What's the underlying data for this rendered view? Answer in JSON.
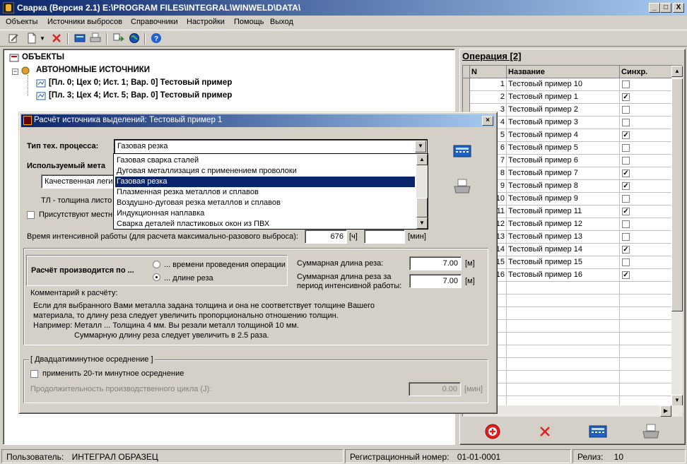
{
  "window": {
    "title": "Сварка (Версия 2.1) E:\\PROGRAM FILES\\INTEGRAL\\WINWELD\\DATA\\",
    "min": "_",
    "max": "□",
    "close": "X"
  },
  "menu": [
    "Объекты",
    "Источники выбросов",
    "Справочники",
    "Настройки",
    "Помощь",
    "Выход"
  ],
  "tree": {
    "root": "ОБЪЕКТЫ",
    "node": "АВТОНОМНЫЕ ИСТОЧНИКИ",
    "items": [
      "[Пл. 0; Цех 0; Ист. 1; Вар. 0] Тестовый пример",
      "[Пл. 3; Цех 4; Ист. 5; Вар. 0] Тестовый пример"
    ]
  },
  "operations": {
    "title": "Операция [2]",
    "columns": [
      "N",
      "Название",
      "Синхр."
    ],
    "rows": [
      {
        "n": "1",
        "name": "Тестовый пример 10",
        "sync": false
      },
      {
        "n": "2",
        "name": "Тестовый пример 1",
        "sync": true
      },
      {
        "n": "3",
        "name": "Тестовый пример 2",
        "sync": false
      },
      {
        "n": "4",
        "name": "Тестовый пример 3",
        "sync": false
      },
      {
        "n": "5",
        "name": "Тестовый пример 4",
        "sync": true
      },
      {
        "n": "6",
        "name": "Тестовый пример 5",
        "sync": false
      },
      {
        "n": "7",
        "name": "Тестовый пример 6",
        "sync": false
      },
      {
        "n": "8",
        "name": "Тестовый пример 7",
        "sync": true
      },
      {
        "n": "9",
        "name": "Тестовый пример 8",
        "sync": true
      },
      {
        "n": "10",
        "name": "Тестовый пример 9",
        "sync": false
      },
      {
        "n": "11",
        "name": "Тестовый пример 11",
        "sync": true
      },
      {
        "n": "12",
        "name": "Тестовый пример 12",
        "sync": false
      },
      {
        "n": "13",
        "name": "Тестовый пример 13",
        "sync": false
      },
      {
        "n": "14",
        "name": "Тестовый пример 14",
        "sync": true
      },
      {
        "n": "15",
        "name": "Тестовый пример 15",
        "sync": false
      },
      {
        "n": "16",
        "name": "Тестовый пример 16",
        "sync": true
      }
    ]
  },
  "dialog": {
    "title": "Расчёт источника выделений: Тестовый пример 1",
    "close": "×",
    "process_label": "Тип тех. процесса:",
    "process_value": "Газовая резка",
    "metal_label": "Используемый мета",
    "metal_value": "Качественная леги",
    "tl_label": "ТЛ - толщина листо",
    "local_label": "Присутствуют местн",
    "dropdown": [
      "Газовая сварка сталей",
      "Дуговая металлизация с применением проволоки",
      "Газовая резка",
      "Плазменная резка металлов и сплавов",
      "Воздушно-дуговая резка металлов и сплавов",
      "Индукционная наплавка",
      "Сварка деталей пластиковых окон из ПВХ"
    ],
    "dropdown_selected": 2,
    "intensive_label": "Время интенсивной работы (для расчета максимально-разового выброса):",
    "intensive_hours": "676",
    "unit_h": "[ч]",
    "intensive_min": "",
    "unit_min": "[мин]",
    "calc_by_label": "Расчёт производится по ...",
    "radio_time": "... времени проведения операции",
    "radio_length": "... длине реза",
    "total_len_label": "Суммарная длина реза:",
    "total_len_value": "7.00",
    "unit_m": "[м]",
    "total_len_int_label1": "Суммарная длина реза за",
    "total_len_int_label2": "период интенсивной работы:",
    "total_len_int_value": "7.00",
    "comment_title": "Комментарий к расчёту:",
    "comment_lines": [
      "Если для выбранного Вами металла задана толщина и она не соответствует толщине Вашего",
      "материала, то длину реза следует увеличить пропорционально отношению толщин.",
      "Например:  Металл ...    Толщина 4 мм. Вы резали металл толщиной 10 мм.",
      "Суммарную длину реза следует увеличить в 2.5 раза."
    ],
    "twenty_group": "[ Двадцатиминутное осреднение ]",
    "twenty_check": "применить 20-ти минутное осреднение",
    "cycle_label": "Продолжительность производственного цикла (J):",
    "cycle_value": "0.00",
    "unit_min2": "[мин]"
  },
  "status": {
    "user_label": "Пользователь:",
    "user_value": "ИНТЕГРАЛ ОБРАЗЕЦ",
    "reg_label": "Регистрационный номер:",
    "reg_value": "01-01-0001",
    "release_label": "Релиз:",
    "release_value": "10"
  },
  "colors": {
    "title_start": "#0a246a",
    "title_end": "#a6caf0",
    "selection": "#0a246a",
    "delete_red": "#e02020"
  }
}
